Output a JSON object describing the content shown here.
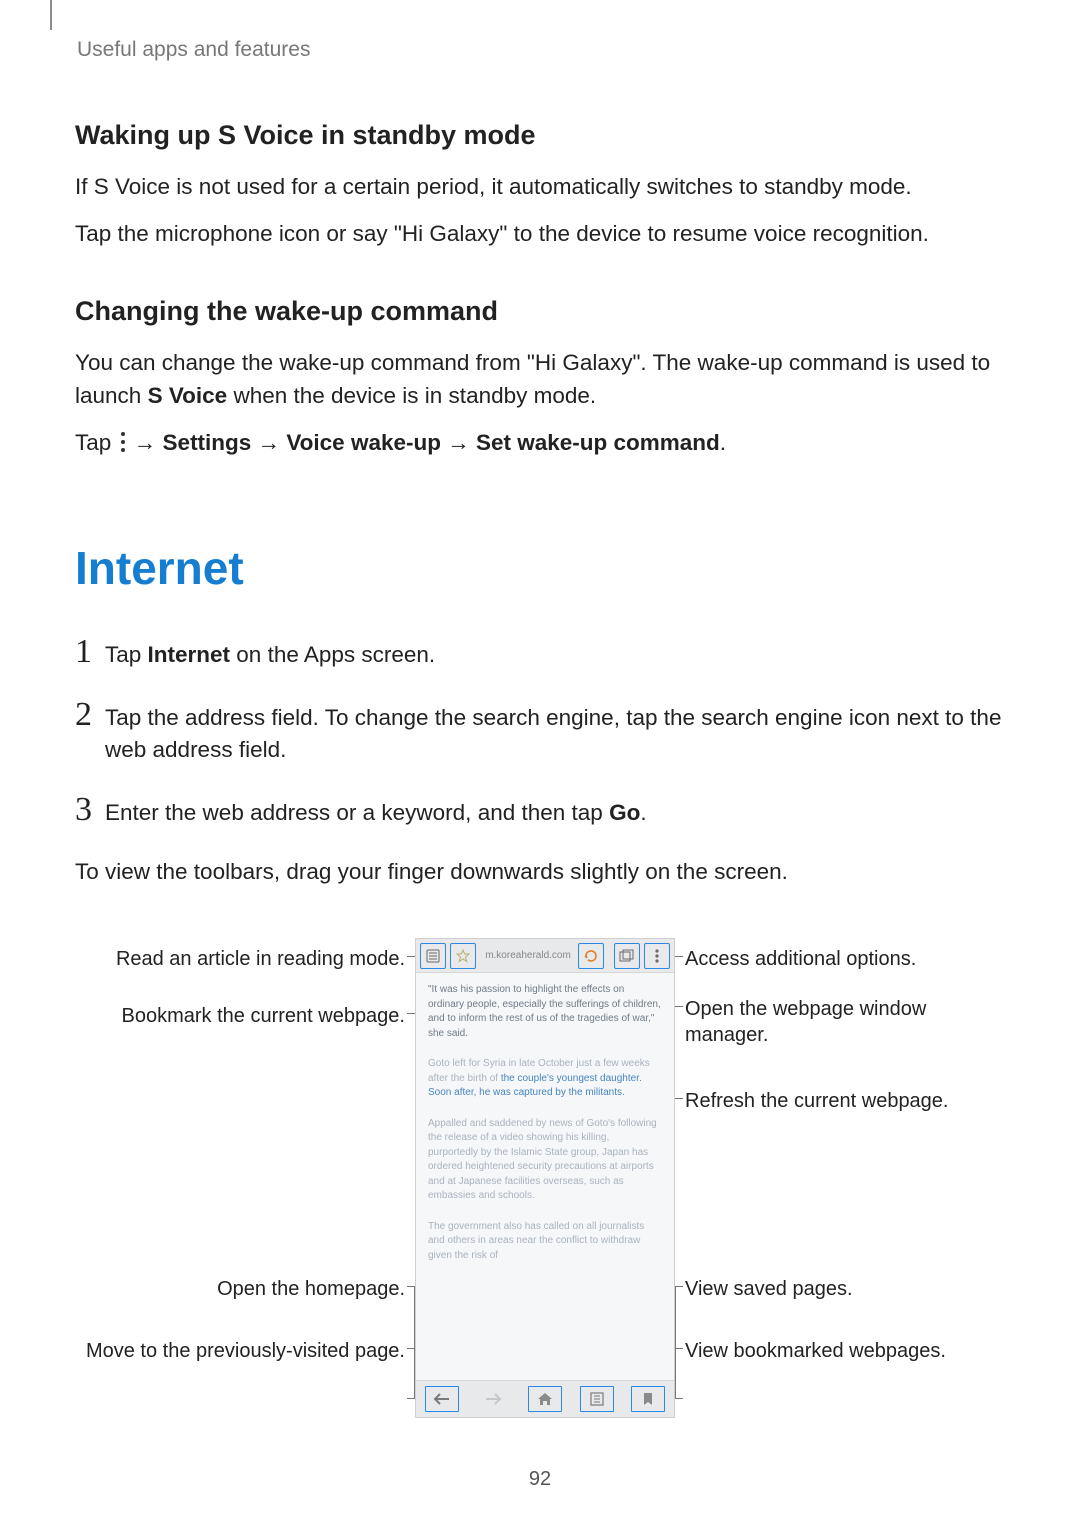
{
  "running_head": "Useful apps and features",
  "svoice": {
    "standby_heading": "Waking up S Voice in standby mode",
    "standby_p1": "If S Voice is not used for a certain period, it automatically switches to standby mode.",
    "standby_p2": "Tap the microphone icon or say \"Hi Galaxy\" to the device to resume voice recognition.",
    "change_heading": "Changing the wake-up command",
    "change_p_pre": "You can change the wake-up command from \"Hi Galaxy\". The wake-up command is used to launch ",
    "change_p_strong": "S Voice",
    "change_p_post": " when the device is in standby mode.",
    "tap_prefix": "Tap ",
    "tap_arrow1": " → ",
    "tap_b1": "Settings",
    "tap_arrow2": " → ",
    "tap_b2": "Voice wake-up",
    "tap_arrow3": " → ",
    "tap_b3": "Set wake-up command",
    "tap_period": "."
  },
  "internet": {
    "title": "Internet",
    "steps": [
      {
        "n": "1",
        "pre": "Tap ",
        "b": "Internet",
        "post": " on the Apps screen."
      },
      {
        "n": "2",
        "pre": "Tap the address field. To change the search engine, tap the search engine icon next to the web address field.",
        "b": "",
        "post": ""
      },
      {
        "n": "3",
        "pre": "Enter the web address or a keyword, and then tap ",
        "b": "Go",
        "post": "."
      }
    ],
    "after": "To view the toolbars, drag your finger downwards slightly on the screen."
  },
  "callouts": {
    "left": [
      "Read an article in reading mode.",
      "Bookmark the current webpage.",
      "Open the homepage.",
      "Move to the previously-visited page."
    ],
    "right": [
      "Access additional options.",
      "Open the webpage window manager.",
      "Refresh the current webpage.",
      "View saved pages.",
      "View bookmarked webpages."
    ]
  },
  "phone": {
    "url": "m.koreaherald.com",
    "paragraphs": [
      "\"It was his passion to highlight the effects on ordinary people, especially the sufferings of children, and to inform the rest of us of the tragedies of war,\" she said.",
      "Goto left for Syria in late October just a few weeks after the birth of ",
      "Appalled and saddened by news of Goto's following the release of a video showing his killing, purportedly by the Islamic State group, Japan has ordered heightened security precautions at airports and at Japanese facilities overseas, such as embassies and schools.",
      "The government also has called on all journalists and others in areas near the conflict to withdraw given the risk of"
    ],
    "link_frag_1": "the couple's youngest daughter. Soon after, he was captured by the militants."
  },
  "page_number": "92"
}
